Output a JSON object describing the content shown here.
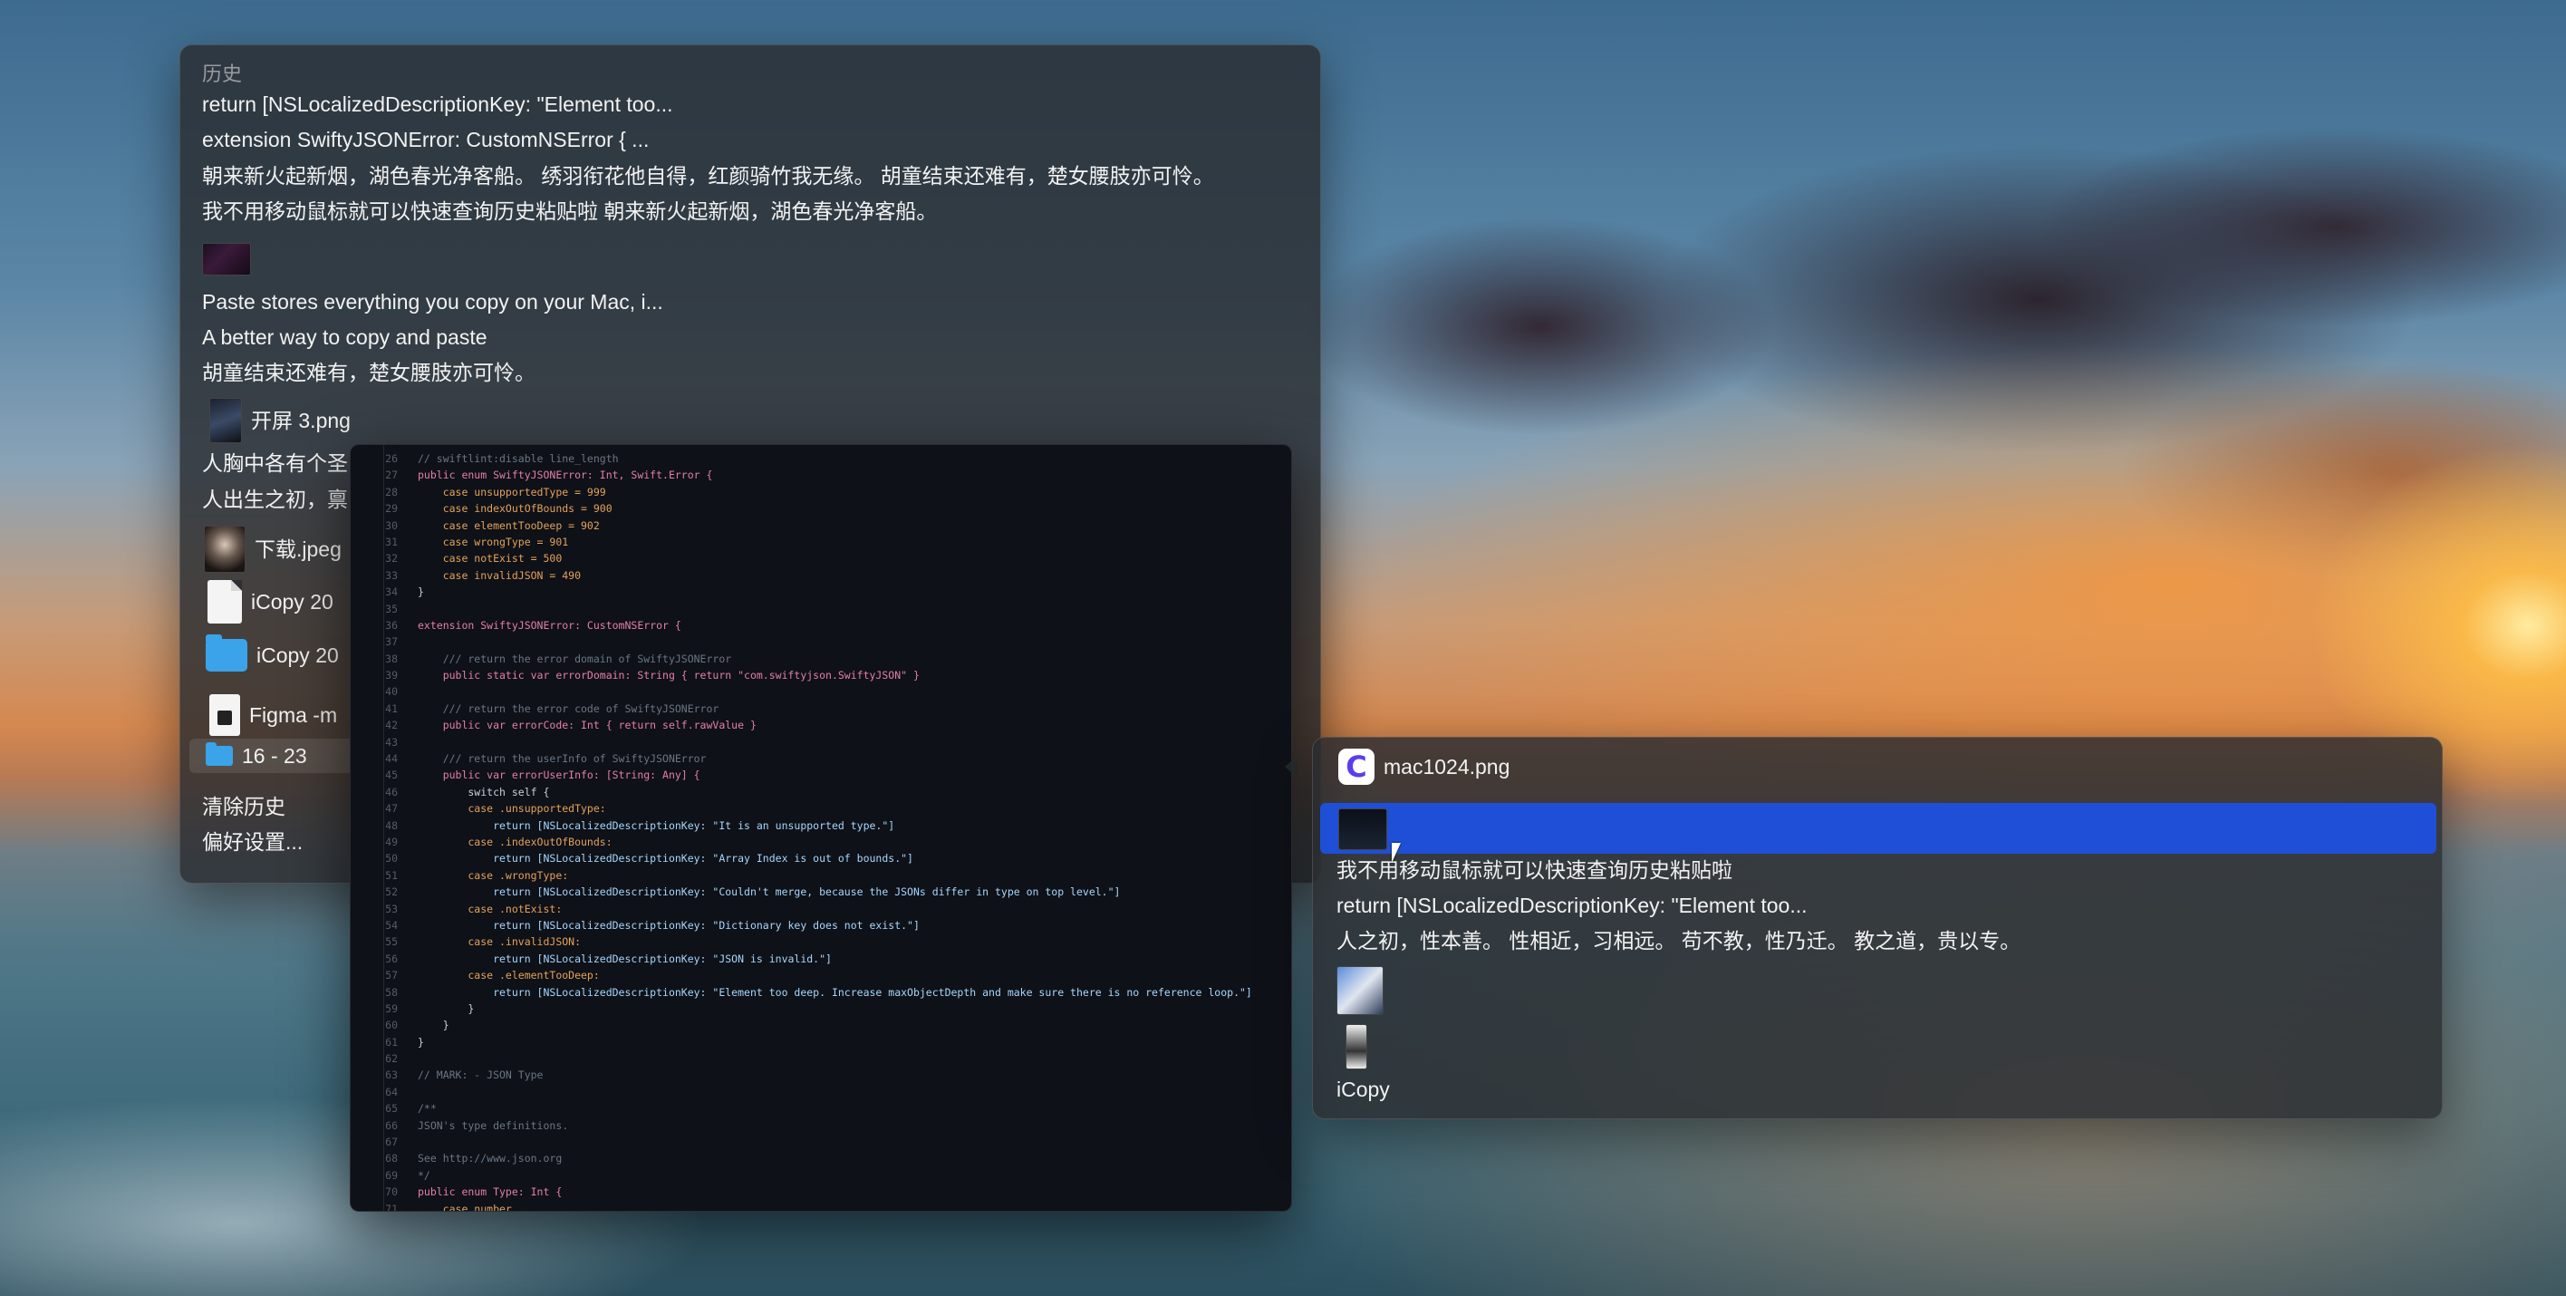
{
  "history": {
    "header": "历史",
    "items": [
      "return [NSLocalizedDescriptionKey: \"Element too...",
      "extension SwiftyJSONError: CustomNSError {     ...",
      "朝来新火起新烟，湖色春光净客船。 绣羽衔花他自得，红颜骑竹我无缘。 胡童结束还难有，楚女腰肢亦可怜。",
      "我不用移动鼠标就可以快速查询历史粘贴啦 朝来新火起新烟，湖色春光净客船。",
      "Paste stores everything you copy on your Mac, i...",
      "A better way to copy and paste",
      "胡童结束还难有，楚女腰肢亦可怜。",
      "开屏 3.png",
      "人胸中各有个圣",
      "人出生之初，禀",
      "下载.jpeg",
      "iCopy 20",
      "iCopy 20",
      "Figma -m",
      "16 - 23"
    ],
    "clear_label": "清除历史",
    "prefs_label": "偏好设置..."
  },
  "code": {
    "lines": [
      [
        "26",
        "// swiftlint:disable line_length"
      ],
      [
        "27",
        "public enum SwiftyJSONError: Int, Swift.Error {"
      ],
      [
        "28",
        "    case unsupportedType = 999"
      ],
      [
        "29",
        "    case indexOutOfBounds = 900"
      ],
      [
        "30",
        "    case elementTooDeep = 902"
      ],
      [
        "31",
        "    case wrongType = 901"
      ],
      [
        "32",
        "    case notExist = 500"
      ],
      [
        "33",
        "    case invalidJSON = 490"
      ],
      [
        "34",
        "}"
      ],
      [
        "35",
        ""
      ],
      [
        "36",
        "extension SwiftyJSONError: CustomNSError {"
      ],
      [
        "37",
        ""
      ],
      [
        "38",
        "    /// return the error domain of SwiftyJSONError"
      ],
      [
        "39",
        "    public static var errorDomain: String { return \"com.swiftyjson.SwiftyJSON\" }"
      ],
      [
        "40",
        ""
      ],
      [
        "41",
        "    /// return the error code of SwiftyJSONError"
      ],
      [
        "42",
        "    public var errorCode: Int { return self.rawValue }"
      ],
      [
        "43",
        ""
      ],
      [
        "44",
        "    /// return the userInfo of SwiftyJSONError"
      ],
      [
        "45",
        "    public var errorUserInfo: [String: Any] {"
      ],
      [
        "46",
        "        switch self {"
      ],
      [
        "47",
        "        case .unsupportedType:"
      ],
      [
        "48",
        "            return [NSLocalizedDescriptionKey: \"It is an unsupported type.\"]"
      ],
      [
        "49",
        "        case .indexOutOfBounds:"
      ],
      [
        "50",
        "            return [NSLocalizedDescriptionKey: \"Array Index is out of bounds.\"]"
      ],
      [
        "51",
        "        case .wrongType:"
      ],
      [
        "52",
        "            return [NSLocalizedDescriptionKey: \"Couldn't merge, because the JSONs differ in type on top level.\"]"
      ],
      [
        "53",
        "        case .notExist:"
      ],
      [
        "54",
        "            return [NSLocalizedDescriptionKey: \"Dictionary key does not exist.\"]"
      ],
      [
        "55",
        "        case .invalidJSON:"
      ],
      [
        "56",
        "            return [NSLocalizedDescriptionKey: \"JSON is invalid.\"]"
      ],
      [
        "57",
        "        case .elementTooDeep:"
      ],
      [
        "58",
        "            return [NSLocalizedDescriptionKey: \"Element too deep. Increase maxObjectDepth and make sure there is no reference loop.\"]"
      ],
      [
        "59",
        "        }"
      ],
      [
        "60",
        "    }"
      ],
      [
        "61",
        "}"
      ],
      [
        "62",
        ""
      ],
      [
        "63",
        "// MARK: - JSON Type"
      ],
      [
        "64",
        ""
      ],
      [
        "65",
        "/**"
      ],
      [
        "66",
        "JSON's type definitions."
      ],
      [
        "67",
        ""
      ],
      [
        "68",
        "See http://www.json.org"
      ],
      [
        "69",
        "*/"
      ],
      [
        "70",
        "public enum Type: Int {"
      ],
      [
        "71",
        "    case number"
      ]
    ]
  },
  "recent": {
    "items": [
      "mac1024.png",
      "",
      "我不用移动鼠标就可以快速查询历史粘贴啦",
      "return [NSLocalizedDescriptionKey: \"Element too...",
      "人之初，性本善。 性相近，习相远。 苟不教，性乃迁。 教之道，贵以专。",
      "",
      "",
      "iCopy"
    ]
  },
  "colors": {
    "selection": "#1f4fd6",
    "panel_bg": "#2a2c30",
    "code_bg": "#0e1117"
  }
}
